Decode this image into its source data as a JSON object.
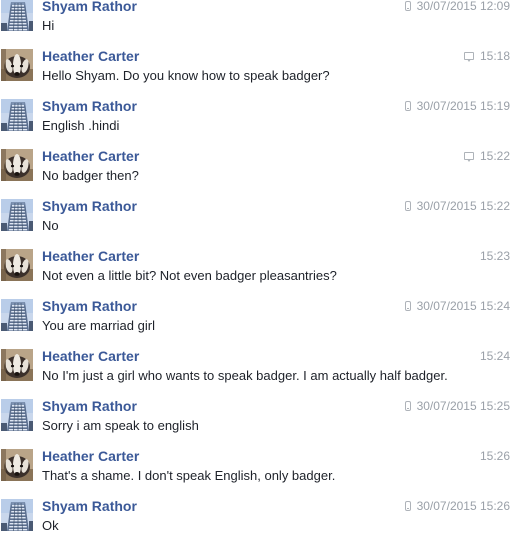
{
  "conversation": {
    "messages": [
      {
        "sender": "Shyam Rathor",
        "avatar": "building-avatar",
        "source_icon": "mobile-icon",
        "time": "30/07/2015 12:09",
        "text": "Hi"
      },
      {
        "sender": "Heather Carter",
        "avatar": "badger-avatar",
        "source_icon": "chat-icon",
        "time": "15:18",
        "text": "Hello Shyam. Do you know how to speak badger?"
      },
      {
        "sender": "Shyam Rathor",
        "avatar": "building-avatar",
        "source_icon": "mobile-icon",
        "time": "30/07/2015 15:19",
        "text": "English  .hindi"
      },
      {
        "sender": "Heather Carter",
        "avatar": "badger-avatar",
        "source_icon": "chat-icon",
        "time": "15:22",
        "text": "No badger then?"
      },
      {
        "sender": "Shyam Rathor",
        "avatar": "building-avatar",
        "source_icon": "mobile-icon",
        "time": "30/07/2015 15:22",
        "text": "No"
      },
      {
        "sender": "Heather Carter",
        "avatar": "badger-avatar",
        "source_icon": "",
        "time": "15:23",
        "text": "Not even a little bit? Not even badger pleasantries?"
      },
      {
        "sender": "Shyam Rathor",
        "avatar": "building-avatar",
        "source_icon": "mobile-icon",
        "time": "30/07/2015 15:24",
        "text": "You are marriad girl"
      },
      {
        "sender": "Heather Carter",
        "avatar": "badger-avatar",
        "source_icon": "",
        "time": "15:24",
        "text": "No I'm just a girl who wants to speak badger. I am actually half badger."
      },
      {
        "sender": "Shyam Rathor",
        "avatar": "building-avatar",
        "source_icon": "mobile-icon",
        "time": "30/07/2015 15:25",
        "text": "Sorry i am speak to english"
      },
      {
        "sender": "Heather Carter",
        "avatar": "badger-avatar",
        "source_icon": "",
        "time": "15:26",
        "text": "That's a shame. I don't speak English, only badger."
      },
      {
        "sender": "Shyam Rathor",
        "avatar": "building-avatar",
        "source_icon": "mobile-icon",
        "time": "30/07/2015 15:26",
        "text": "Ok"
      }
    ]
  },
  "colors": {
    "sender_name": "#3b5998",
    "message_text": "#1d2129",
    "timestamp": "#9aa0a8"
  }
}
